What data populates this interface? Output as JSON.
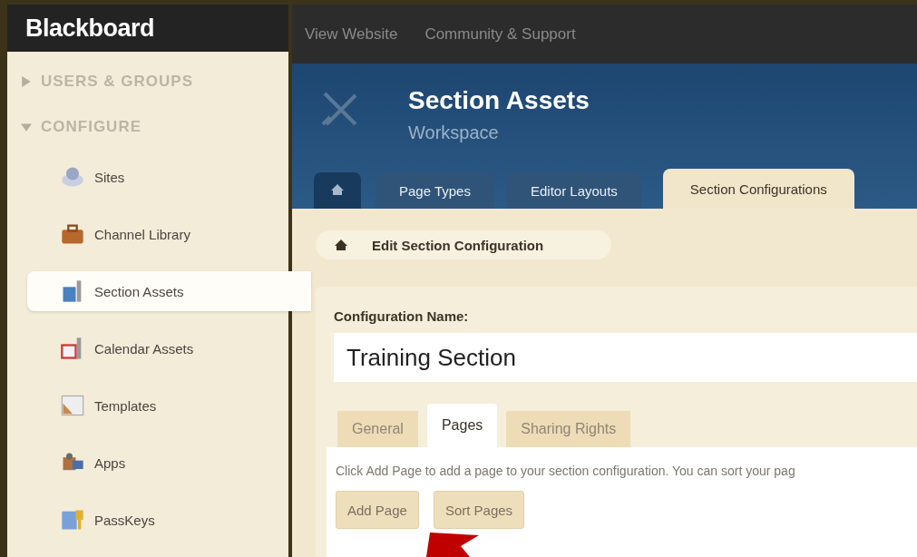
{
  "brand": "Blackboard",
  "top_links": [
    "View Website",
    "Community & Support"
  ],
  "sidebar": {
    "groups": [
      {
        "label": "USERS & GROUPS",
        "expanded": false
      },
      {
        "label": "CONFIGURE",
        "expanded": true,
        "items": [
          {
            "label": "Sites",
            "selected": false
          },
          {
            "label": "Channel Library",
            "selected": false
          },
          {
            "label": "Section Assets",
            "selected": true
          },
          {
            "label": "Calendar Assets",
            "selected": false
          },
          {
            "label": "Templates",
            "selected": false
          },
          {
            "label": "Apps",
            "selected": false
          },
          {
            "label": "PassKeys",
            "selected": false
          }
        ]
      }
    ]
  },
  "banner": {
    "title": "Section Assets",
    "subtitle": "Workspace"
  },
  "tabs": [
    {
      "label": "Page Types",
      "selected": false
    },
    {
      "label": "Editor Layouts",
      "selected": false
    },
    {
      "label": "Section Configurations",
      "selected": true
    }
  ],
  "breadcrumb": "Edit Section Configuration",
  "form": {
    "label": "Configuration Name:",
    "value": "Training Section"
  },
  "subtabs": [
    {
      "label": "General",
      "selected": false
    },
    {
      "label": "Pages",
      "selected": true
    },
    {
      "label": "Sharing Rights",
      "selected": false
    }
  ],
  "description": "Click Add Page to add a page to your section configuration. You can sort your pag",
  "buttons": [
    "Add Page",
    "Sort Pages"
  ]
}
